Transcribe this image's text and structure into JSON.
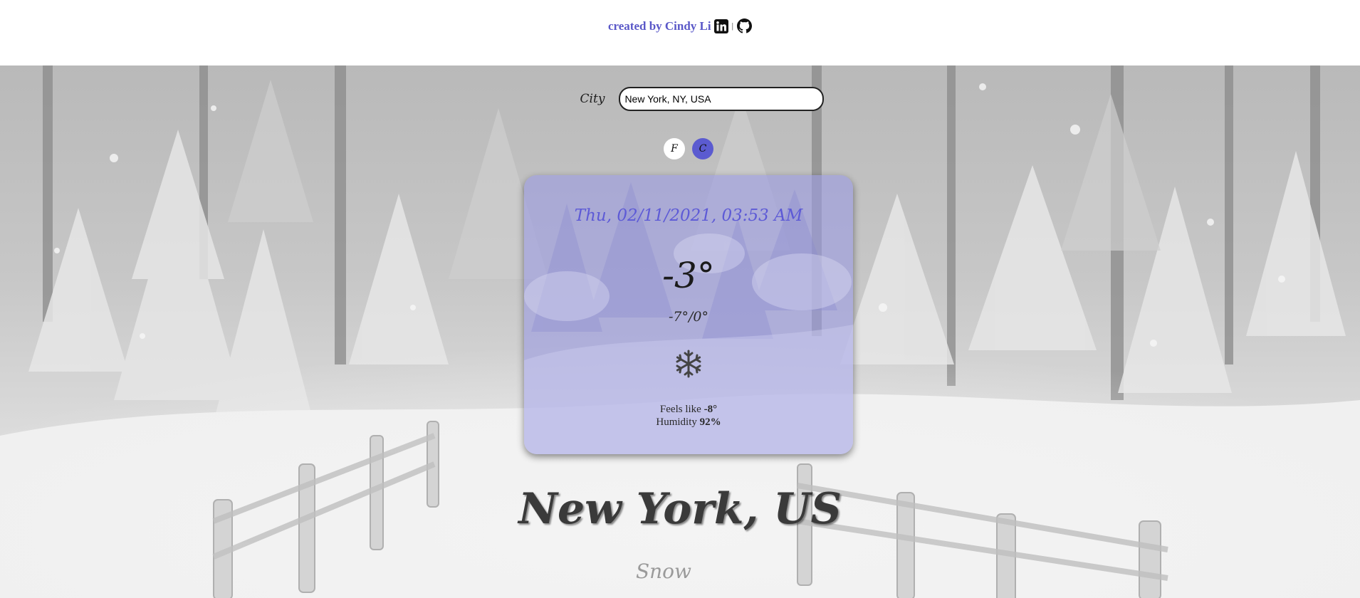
{
  "header": {
    "credit_text": "created by Cindy Li",
    "separator": "|",
    "linkedin_icon": "linkedin-icon",
    "github_icon": "github-icon"
  },
  "search": {
    "label": "City",
    "value": "New York, NY, USA",
    "placeholder": ""
  },
  "units": {
    "fahrenheit_label": "F",
    "celsius_label": "C",
    "selected": "C"
  },
  "card": {
    "datetime": "Thu, 02/11/2021, 03:53 AM",
    "temperature": "-3°",
    "range": "-7°/0°",
    "weather_icon": "snowflake-icon",
    "feels_like_label": "Feels like",
    "feels_like_value": "-8°",
    "humidity_label": "Humidity",
    "humidity_value": "92%"
  },
  "location": {
    "city": "New York, US",
    "condition": "Snow"
  },
  "colors": {
    "accent": "#5b5bd0",
    "credit": "#5a58c8",
    "card_tint": "#9b9be1"
  }
}
